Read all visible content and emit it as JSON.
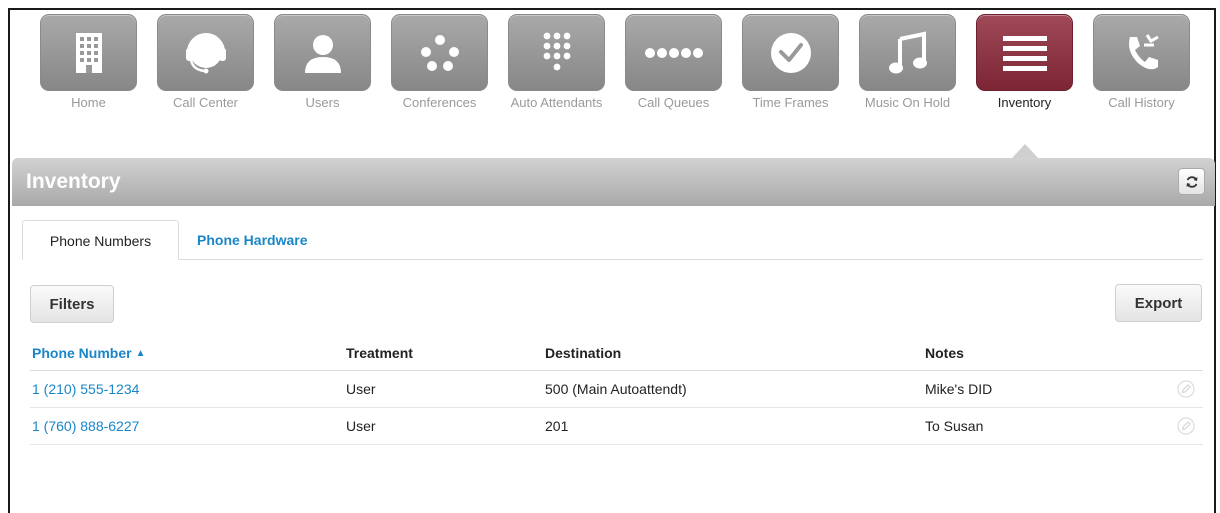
{
  "nav": {
    "items": [
      {
        "label": "Home",
        "icon": "building-icon"
      },
      {
        "label": "Call Center",
        "icon": "headset-icon"
      },
      {
        "label": "Users",
        "icon": "user-icon"
      },
      {
        "label": "Conferences",
        "icon": "conference-dots-icon"
      },
      {
        "label": "Auto Attendants",
        "icon": "keypad-icon"
      },
      {
        "label": "Call Queues",
        "icon": "queue-dots-icon"
      },
      {
        "label": "Time Frames",
        "icon": "clock-icon"
      },
      {
        "label": "Music On Hold",
        "icon": "music-note-icon"
      },
      {
        "label": "Inventory",
        "icon": "list-icon"
      },
      {
        "label": "Call History",
        "icon": "phone-history-icon"
      }
    ],
    "active_index": 8,
    "colors": {
      "tile": "#9a9a9a",
      "active_tile": "#8c3344"
    }
  },
  "section": {
    "title": "Inventory",
    "refresh_icon": "refresh-icon"
  },
  "tabs": {
    "phone_numbers": "Phone Numbers",
    "phone_hardware": "Phone Hardware"
  },
  "toolbar": {
    "filters_label": "Filters",
    "export_label": "Export"
  },
  "table": {
    "headers": {
      "phone_number": "Phone Number",
      "sort_indicator": "▲",
      "treatment": "Treatment",
      "destination": "Destination",
      "notes": "Notes"
    },
    "rows": [
      {
        "phone_number": "1 (210) 555-1234",
        "treatment": "User",
        "destination": "500 (Main Autoattendt)",
        "notes": "Mike's DID"
      },
      {
        "phone_number": "1 (760) 888-6227",
        "treatment": "User",
        "destination": "201",
        "notes": "To Susan"
      }
    ]
  },
  "accent_color": "#1a86c8"
}
